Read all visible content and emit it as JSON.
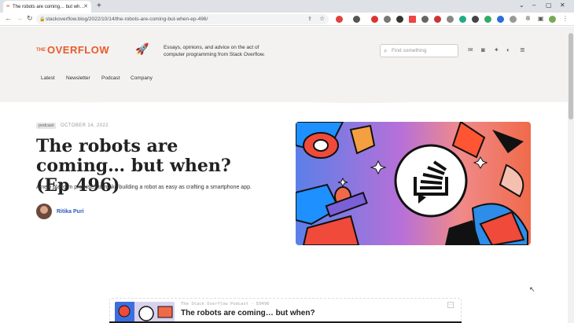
{
  "browser": {
    "tab_title": "The robots are coming… but wh…",
    "url": "stackoverflow.blog/2022/10/14/the-robots-are-coming-but-when-ep-496/"
  },
  "site": {
    "logo_the": "THE",
    "logo_name": "OVERFLOW",
    "tagline": "Essays, opinions, and advice on the act of computer programming from Stack Overflow.",
    "search_placeholder": "Find something",
    "nav": [
      "Latest",
      "Newsletter",
      "Podcast",
      "Company"
    ]
  },
  "article": {
    "category": "podcast",
    "date": "OCTOBER 14, 2022",
    "title": "The robots are coming… but when? (Ep 496)",
    "excerpt": "A new platform promises to make building a robot as easy as crafting a smartphone app.",
    "author": "Ritika Puri"
  },
  "player": {
    "show": "The Stack Overflow Podcast · E0496",
    "title": "The robots are coming… but when?"
  },
  "colors": {
    "brand": "#e85a2b",
    "link": "#2a5bb8"
  }
}
